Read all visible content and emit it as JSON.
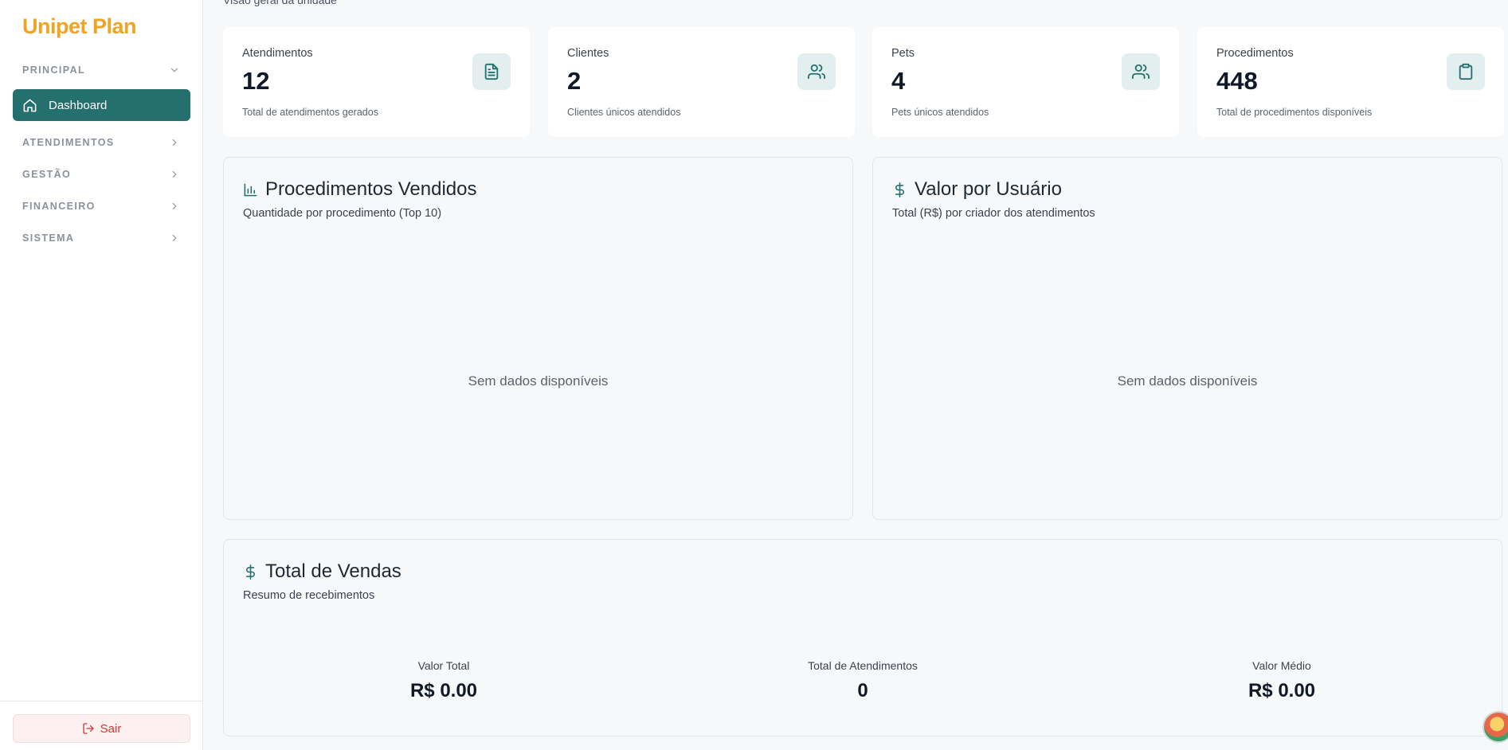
{
  "app": {
    "logo_text": "Unipet Plan",
    "page_subtitle": "Visão geral da unidade"
  },
  "sidebar": {
    "sections": [
      {
        "label": "PRINCIPAL",
        "expanded": true
      },
      {
        "label": "ATENDIMENTOS",
        "expanded": false
      },
      {
        "label": "GESTÃO",
        "expanded": false
      },
      {
        "label": "FINANCEIRO",
        "expanded": false
      },
      {
        "label": "SISTEMA",
        "expanded": false
      }
    ],
    "active_item": {
      "label": "Dashboard",
      "icon": "home-icon"
    },
    "logout_label": "Sair"
  },
  "stats": [
    {
      "label": "Atendimentos",
      "value": "12",
      "description": "Total de atendimentos gerados",
      "icon": "file-text-icon"
    },
    {
      "label": "Clientes",
      "value": "2",
      "description": "Clientes únicos atendidos",
      "icon": "users-icon"
    },
    {
      "label": "Pets",
      "value": "4",
      "description": "Pets únicos atendidos",
      "icon": "users-icon"
    },
    {
      "label": "Procedimentos",
      "value": "448",
      "description": "Total de procedimentos disponíveis",
      "icon": "clipboard-icon"
    }
  ],
  "panels": {
    "procedures": {
      "title": "Procedimentos Vendidos",
      "subtitle": "Quantidade por procedimento (Top 10)",
      "empty_message": "Sem dados disponíveis"
    },
    "user_value": {
      "title": "Valor por Usuário",
      "subtitle": "Total (R$) por criador dos atendimentos",
      "empty_message": "Sem dados disponíveis"
    },
    "sales": {
      "title": "Total de Vendas",
      "subtitle": "Resumo de recebimentos",
      "metrics": [
        {
          "label": "Valor Total",
          "value": "R$ 0.00"
        },
        {
          "label": "Total de Atendimentos",
          "value": "0"
        },
        {
          "label": "Valor Médio",
          "value": "R$ 0.00"
        }
      ]
    }
  },
  "colors": {
    "brand": "#f0a424",
    "accent": "#24706e",
    "icon_bg": "#e3efee",
    "danger": "#d6363a"
  }
}
